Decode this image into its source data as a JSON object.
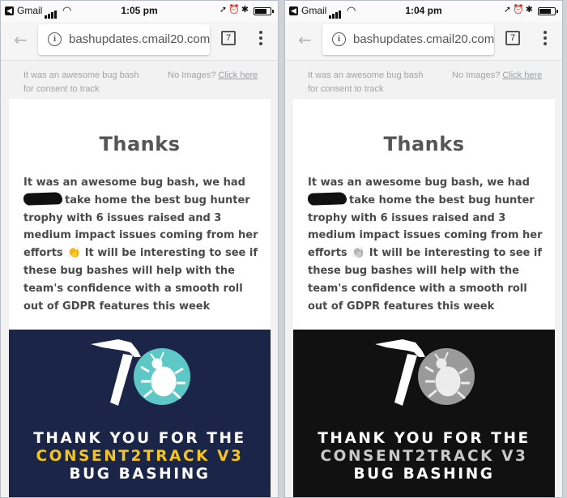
{
  "status_bar": {
    "carrier": "Gmail",
    "back_chip": "◀",
    "battery_level": 0.85
  },
  "browser": {
    "url": "bashupdates.cmail20.com",
    "tab_count": "7"
  },
  "preheader": {
    "left_text": "It was an awesome bug bash for consent to track",
    "right_prefix": "No Images?",
    "right_link": "Click here"
  },
  "email": {
    "headline": "Thanks",
    "body_part1": "It was an awesome bug bash, we had",
    "body_part2": "take home the best bug hunter trophy with 6 issues raised and 3 medium impact issues coming from her efforts",
    "clap_emoji": "👏",
    "body_part3": "It will be interesting to see if these bug bashes will help with the team's confidence with a smooth roll out of GDPR features this week"
  },
  "banner": {
    "line1": "THANK YOU FOR THE",
    "line2": "CONSENT2TRACK V3",
    "line3": "BUG BASHING"
  },
  "screens": [
    {
      "id": "color",
      "time": "1:05 pm",
      "colors": {
        "banner_bg": "#1a2547",
        "hammer": "#ffffff",
        "bug_circle": "#5ec8c6",
        "bug": "#ffffff",
        "line1": "#ffffff",
        "line2": "#f5c518",
        "line3": "#ffffff",
        "clap": "#f2b03a"
      }
    },
    {
      "id": "grayscale",
      "time": "1:04 pm",
      "colors": {
        "banner_bg": "#111111",
        "hammer": "#ffffff",
        "bug_circle": "#9a9a9a",
        "bug": "#ececec",
        "line1": "#ffffff",
        "line2": "#c8c8c8",
        "line3": "#ffffff",
        "clap": "#9c9c9c"
      }
    }
  ]
}
